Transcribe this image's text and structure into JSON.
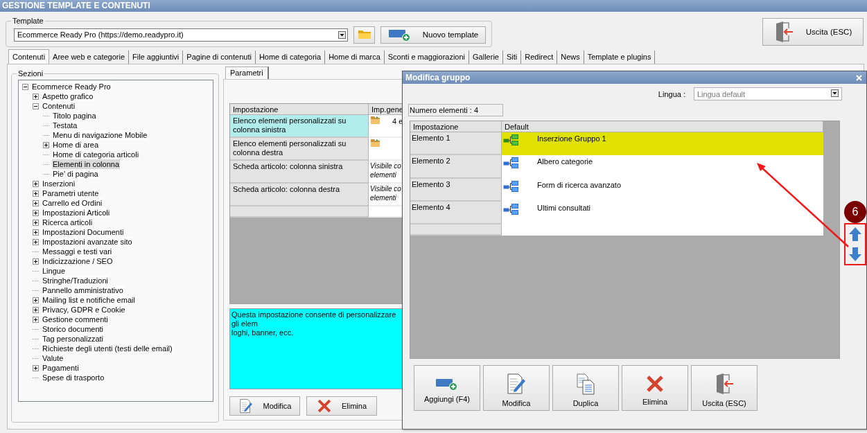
{
  "window": {
    "title": "GESTIONE TEMPLATE E CONTENUTI"
  },
  "template": {
    "label": "Template",
    "value": "Ecommerce Ready Pro (https://demo.readypro.it)",
    "buttons": [
      {
        "kind": "folder"
      },
      {
        "kind": "add",
        "label": "Nuovo template"
      }
    ]
  },
  "exit_button": {
    "kind": "exit",
    "label": "Uscita (ESC)"
  },
  "tabs": [
    {
      "label": "Contenuti",
      "selected": true
    },
    {
      "label": "Aree web e categorie",
      "selected": false
    },
    {
      "label": "File aggiuntivi",
      "selected": false
    },
    {
      "label": "Pagine di contenuti",
      "selected": false
    },
    {
      "label": "Home di categoria",
      "selected": false
    },
    {
      "label": "Home di marca",
      "selected": false
    },
    {
      "label": "Sconti e maggiorazioni",
      "selected": false
    },
    {
      "label": "Gallerie",
      "selected": false
    },
    {
      "label": "Siti",
      "selected": false
    },
    {
      "label": "Redirect",
      "selected": false
    },
    {
      "label": "News",
      "selected": false
    },
    {
      "label": "Template e plugins",
      "selected": false
    }
  ],
  "sections": {
    "label": "Sezioni",
    "tree": [
      {
        "label": "Ecommerce Ready Pro",
        "kind": "node",
        "expanded": true,
        "selected": false,
        "children": [
          {
            "label": "Aspetto grafico",
            "kind": "node",
            "expanded": false,
            "selected": false
          },
          {
            "label": "Contenuti",
            "kind": "node",
            "expanded": true,
            "selected": false,
            "children": [
              {
                "label": "Titolo pagina",
                "kind": "leaf",
                "selected": false
              },
              {
                "label": "Testata",
                "kind": "leaf",
                "selected": false
              },
              {
                "label": "Menu di navigazione Mobile",
                "kind": "leaf",
                "selected": false
              },
              {
                "label": "Home di area",
                "kind": "node",
                "expanded": false,
                "selected": false
              },
              {
                "label": "Home di categoria articoli",
                "kind": "leaf",
                "selected": false
              },
              {
                "label": "Elementi in colonna",
                "kind": "leaf",
                "selected": true
              },
              {
                "label": "Pie' di pagina",
                "kind": "leaf",
                "selected": false
              }
            ]
          },
          {
            "label": "Inserzioni",
            "kind": "node",
            "expanded": false,
            "selected": false
          },
          {
            "label": "Parametri utente",
            "kind": "node",
            "expanded": false,
            "selected": false
          },
          {
            "label": "Carrello ed Ordini",
            "kind": "node",
            "expanded": false,
            "selected": false
          },
          {
            "label": "Impostazioni Articoli",
            "kind": "node",
            "expanded": false,
            "selected": false
          },
          {
            "label": "Ricerca articoli",
            "kind": "node",
            "expanded": false,
            "selected": false
          },
          {
            "label": "Impostazioni Documenti",
            "kind": "node",
            "expanded": false,
            "selected": false
          },
          {
            "label": "Impostazioni avanzate sito",
            "kind": "node",
            "expanded": false,
            "selected": false
          },
          {
            "label": "Messaggi e testi vari",
            "kind": "leaf",
            "selected": false
          },
          {
            "label": "Indicizzazione / SEO",
            "kind": "node",
            "expanded": false,
            "selected": false
          },
          {
            "label": "Lingue",
            "kind": "leaf",
            "selected": false
          },
          {
            "label": "Stringhe/Traduzioni",
            "kind": "leaf",
            "selected": false
          },
          {
            "label": "Pannello amministrativo",
            "kind": "leaf",
            "selected": false
          },
          {
            "label": "Mailing list e notifiche email",
            "kind": "node",
            "expanded": false,
            "selected": false
          },
          {
            "label": "Privacy, GDPR e Cookie",
            "kind": "node",
            "expanded": false,
            "selected": false
          },
          {
            "label": "Gestione commenti",
            "kind": "node",
            "expanded": false,
            "selected": false
          },
          {
            "label": "Storico documenti",
            "kind": "leaf",
            "selected": false
          },
          {
            "label": "Tag personalizzati",
            "kind": "leaf",
            "selected": false
          },
          {
            "label": "Richieste degli utenti (testi delle email)",
            "kind": "leaf",
            "selected": false
          },
          {
            "label": "Valute",
            "kind": "leaf",
            "selected": false
          },
          {
            "label": "Pagamenti",
            "kind": "node",
            "expanded": false,
            "selected": false
          },
          {
            "label": "Spese di trasporto",
            "kind": "leaf",
            "selected": false
          }
        ]
      }
    ]
  },
  "parameters": {
    "tab": "Parametri",
    "columns": [
      "Impostazione",
      "Imp.gene"
    ],
    "rows": [
      {
        "setting": "Elenco elementi personalizzati su colonna sinistra",
        "kind": "folder",
        "value": "4 e",
        "selected": true
      },
      {
        "setting": "Elenco elementi personalizzati su colonna destra",
        "kind": "folder",
        "selected": false
      },
      {
        "setting": "Scheda articolo: colonna sinistra",
        "kind": "text",
        "lines": [
          "Visibile co",
          "elementi"
        ],
        "selected": false
      },
      {
        "setting": "Scheda articolo: colonna destra",
        "kind": "text",
        "lines": [
          "Visibile co",
          "elementi"
        ],
        "selected": false
      }
    ],
    "description": "Questa impostazione consente di personalizzare gli elem\nloghi, banner, ecc.",
    "buttons": [
      {
        "kind": "edit",
        "label": "Modifica"
      },
      {
        "kind": "delete",
        "label": "Elimina"
      }
    ]
  },
  "dialog": {
    "title": "Modifica gruppo",
    "language_label": "Lingua :",
    "language_value": "Lingua default",
    "count": "Numero elementi : 4",
    "columns": [
      "Impostazione",
      "Default"
    ],
    "rows": [
      {
        "name": "Elemento 1",
        "value": "Inserzione Gruppo 1",
        "selected": true
      },
      {
        "name": "Elemento 2",
        "value": "Albero categorie",
        "selected": false
      },
      {
        "name": "Elemento 3",
        "value": "Form di ricerca avanzato",
        "selected": false
      },
      {
        "name": "Elemento 4",
        "value": "Ultimi consultati",
        "selected": false
      }
    ],
    "buttons": [
      {
        "kind": "add",
        "label": "Aggiungi (F4)"
      },
      {
        "kind": "edit",
        "label": "Modifica"
      },
      {
        "kind": "duplicate",
        "label": "Duplica"
      },
      {
        "kind": "delete",
        "label": "Elimina"
      },
      {
        "kind": "exit",
        "label": "Uscita (ESC)"
      }
    ],
    "step_badge": "6"
  }
}
